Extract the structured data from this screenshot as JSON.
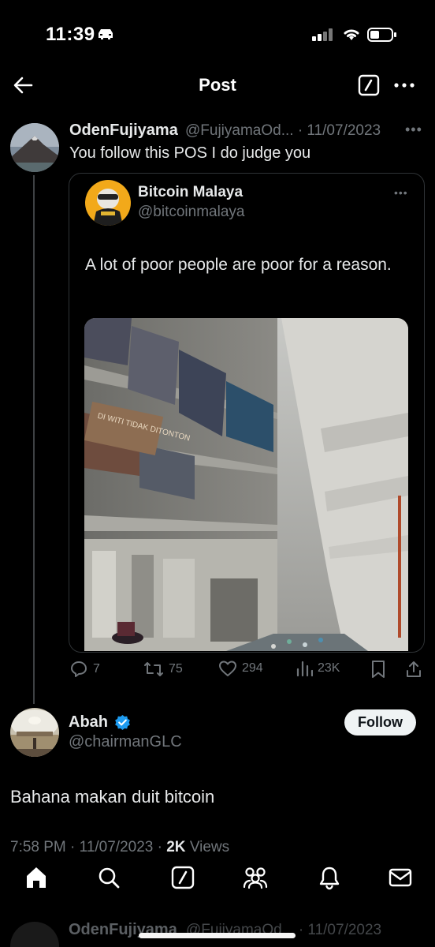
{
  "status_bar": {
    "time": "11:39"
  },
  "header": {
    "title": "Post"
  },
  "tweet": {
    "author": "OdenFujiyama",
    "handle_date": "@FujiyamaOd... · 11/07/2023",
    "text": "You follow this POS I do judge you",
    "quoted": {
      "author": "Bitcoin Malaya",
      "handle": "@bitcoinmalaya",
      "text": "A lot of poor people are poor for a reason.",
      "photo_sign": "DI WITI TIDAK DITONTON"
    },
    "actions": {
      "replies": "7",
      "reposts": "75",
      "likes": "294",
      "views": "23K"
    }
  },
  "reply": {
    "author": "Abah",
    "handle": "@chairmanGLC",
    "follow_label": "Follow",
    "text": "Bahana makan duit bitcoin",
    "time": "7:58 PM",
    "date": "11/07/2023",
    "views_count": "2K",
    "views_label": "Views"
  },
  "next_tweet": {
    "author": "OdenFujiyama",
    "handle_date": "@FujiyamaOd... · 11/07/2023"
  },
  "colors": {
    "background": "#000000",
    "text": "#e7e9ea",
    "muted": "#71767b",
    "border": "#2f3336",
    "verified": "#1d9bf0"
  }
}
